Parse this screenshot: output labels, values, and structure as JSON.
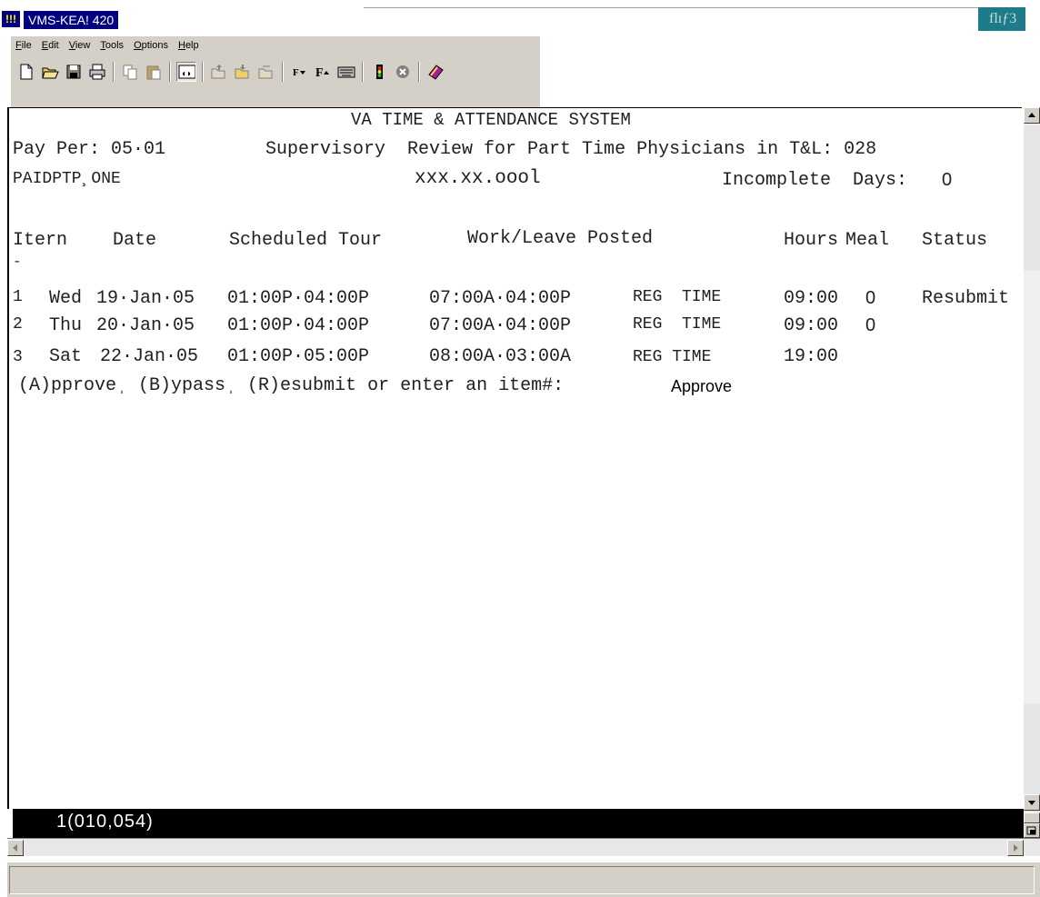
{
  "window": {
    "app_icon_text": "!!!",
    "title": "VMS-KEA! 420",
    "corner_logo": "flıƒ3"
  },
  "menu": [
    {
      "label": "File",
      "key": "F",
      "rest": "ile"
    },
    {
      "label": "Edit",
      "key": "E",
      "rest": "dit"
    },
    {
      "label": "View",
      "key": "V",
      "rest": "iew"
    },
    {
      "label": "Tools",
      "key": "T",
      "rest": "ools"
    },
    {
      "label": "Options",
      "key": "O",
      "rest": "ptions"
    },
    {
      "label": "Help",
      "key": "H",
      "rest": "elp"
    }
  ],
  "toolbar": [
    {
      "icon": "new-document-icon"
    },
    {
      "icon": "open-folder-icon"
    },
    {
      "icon": "save-icon"
    },
    {
      "icon": "print-icon"
    },
    {
      "icon": "copy-icon"
    },
    {
      "icon": "paste-icon"
    },
    {
      "icon": "connect-icon"
    },
    {
      "icon": "send-file-icon"
    },
    {
      "icon": "receive-file-icon"
    },
    {
      "icon": "transfer-icon"
    },
    {
      "icon": "font-decrease-icon"
    },
    {
      "icon": "font-increase-icon"
    },
    {
      "icon": "keyboard-icon"
    },
    {
      "icon": "traffic-light-icon"
    },
    {
      "icon": "stop-icon"
    },
    {
      "icon": "book-icon"
    }
  ],
  "terminal": {
    "system_title": "VA TIME & ATTENDANCE SYSTEM",
    "pay_period_label": "Pay Per: 05·01",
    "review_title": "Supervisory  Review for Part Time Physicians in T&L: 028",
    "employee_name": "PAIDPTP¸ONE",
    "employee_id": "xxx.xx.oool",
    "incomplete_days_label": "Incomplete  Days:",
    "incomplete_days_value": "0",
    "columns": {
      "item": "Itern",
      "date": "Date",
      "scheduled_tour": "Scheduled Tour",
      "work_leave_posted": "Work/Leave Posted",
      "hours": "Hours",
      "meal": "Meal",
      "status": "Status"
    },
    "divider": "-",
    "rows": [
      {
        "item": "1",
        "day": "Wed",
        "date": "19·Jan·05",
        "tour": "01:00P·04:00P",
        "posted": "07:00A·04:00P",
        "type": "REG  TIME",
        "hours": "09:00",
        "meal": "0",
        "status": "Resubmit"
      },
      {
        "item": "2",
        "day": "Thu",
        "date": "20·Jan·05",
        "tour": "01:00P·04:00P",
        "posted": "07:00A·04:00P",
        "type": "REG  TIME",
        "hours": "09:00",
        "meal": "0",
        "status": ""
      },
      {
        "item": "3",
        "day": "Sat",
        "date": "22·Jan·05",
        "tour": "01:00P·05:00P",
        "posted": "08:00A·03:00A",
        "type": "REG TIME",
        "hours": "19:00",
        "meal": "",
        "status": ""
      }
    ],
    "prompt": "(A)pproveˌ (B)ypassˌ (R)esubmit or enter an item#:",
    "response": "Approve"
  },
  "status_line": "1(010,054)"
}
